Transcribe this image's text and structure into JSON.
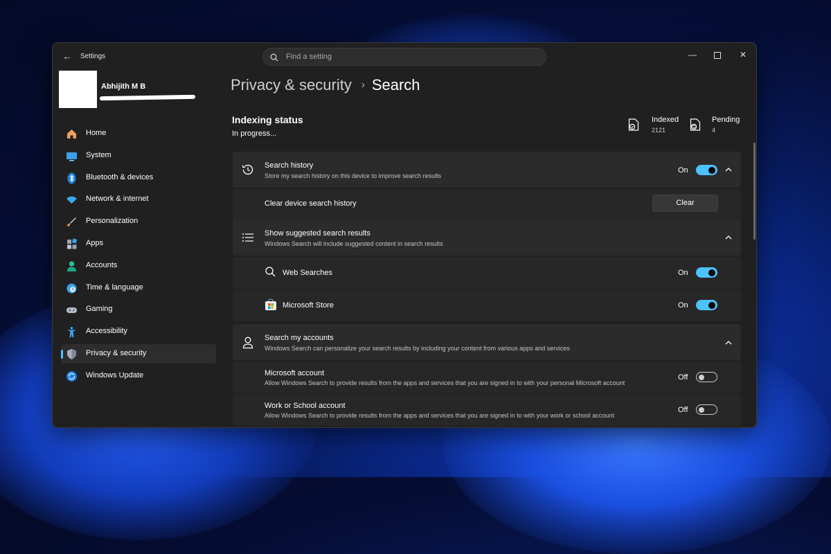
{
  "window": {
    "title": "Settings"
  },
  "search": {
    "placeholder": "Find a setting"
  },
  "user": {
    "name": "Abhijith M B"
  },
  "nav": [
    {
      "label": "Home",
      "icon": "home-icon"
    },
    {
      "label": "System",
      "icon": "system-icon"
    },
    {
      "label": "Bluetooth & devices",
      "icon": "bluetooth-icon"
    },
    {
      "label": "Network & internet",
      "icon": "wifi-icon"
    },
    {
      "label": "Personalization",
      "icon": "brush-icon"
    },
    {
      "label": "Apps",
      "icon": "apps-icon"
    },
    {
      "label": "Accounts",
      "icon": "accounts-icon"
    },
    {
      "label": "Time & language",
      "icon": "clock-globe-icon"
    },
    {
      "label": "Gaming",
      "icon": "gamepad-icon"
    },
    {
      "label": "Accessibility",
      "icon": "accessibility-icon"
    },
    {
      "label": "Privacy & security",
      "icon": "shield-icon",
      "active": true
    },
    {
      "label": "Windows Update",
      "icon": "update-icon"
    }
  ],
  "breadcrumb": {
    "parent": "Privacy & security",
    "separator": "›",
    "current": "Search"
  },
  "indexing": {
    "title": "Indexing status",
    "status": "In progress...",
    "indexed_label": "Indexed",
    "indexed_value": "2121",
    "pending_label": "Pending",
    "pending_value": "4"
  },
  "search_history": {
    "title": "Search history",
    "desc": "Store my search history on this device to improve search results",
    "state": "On",
    "clear_label": "Clear device search history",
    "clear_button": "Clear"
  },
  "suggested": {
    "title": "Show suggested search results",
    "desc": "Windows Search will include suggested content in search results",
    "web_label": "Web Searches",
    "web_state": "On",
    "store_label": "Microsoft Store",
    "store_state": "On"
  },
  "accounts": {
    "title": "Search my accounts",
    "desc": "Windows Search can personalize your search results by including your content from various apps and services",
    "ms_title": "Microsoft account",
    "ms_desc": "Allow Windows Search to provide results from the apps and services that you are signed in to with your personal Microsoft account",
    "ms_state": "Off",
    "work_title": "Work or School account",
    "work_desc": "Allow Windows Search to provide results from the apps and services that you are signed in to with your work or school account",
    "work_state": "Off"
  },
  "colors": {
    "accent": "#4cc2ff",
    "window_bg": "#202020",
    "card_bg": "#2b2b2b"
  }
}
